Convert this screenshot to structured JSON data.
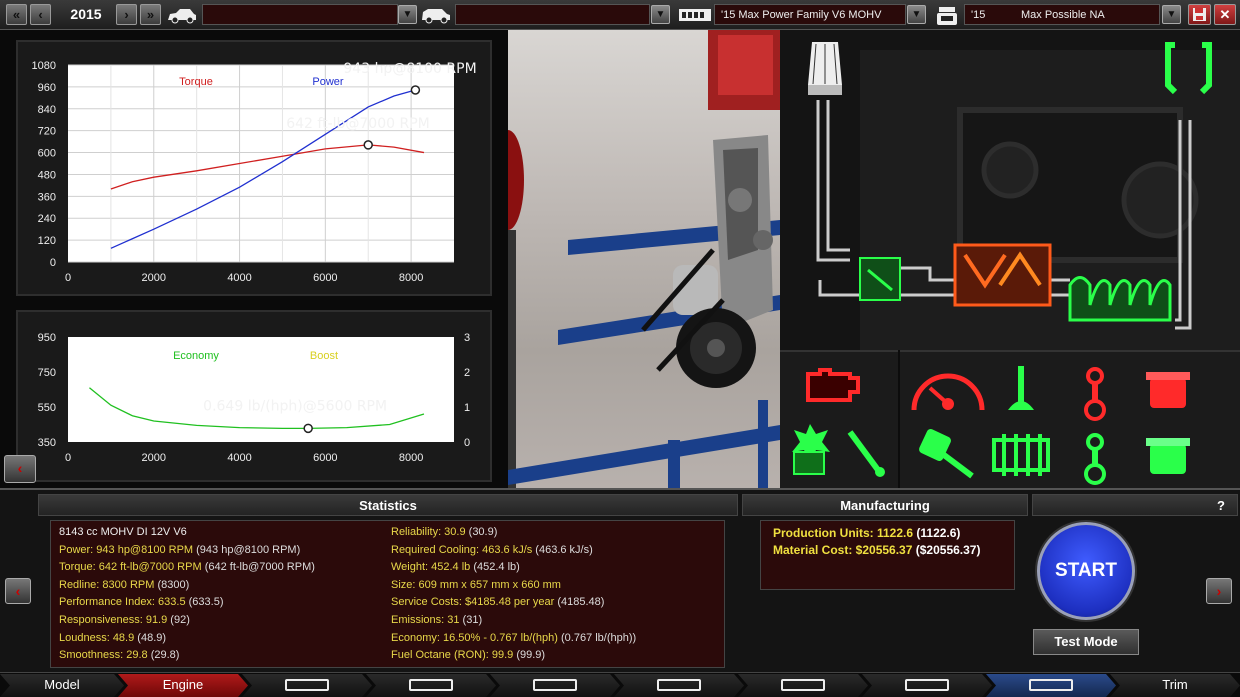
{
  "topbar": {
    "year": "2015",
    "car_model": "",
    "car_trim": "",
    "engine_family": "'15 Max Power Family V6 MOHV",
    "engine_variant_year": "'15",
    "engine_variant": "Max Possible NA",
    "colors": {
      "accent": "#c0392b"
    }
  },
  "chart_data": [
    {
      "type": "line",
      "title": "",
      "legend": [
        "Torque",
        "Power"
      ],
      "xlim": [
        0,
        9000
      ],
      "ylim": [
        0,
        1080
      ],
      "x_ticks": [
        0,
        2000,
        4000,
        6000,
        8000
      ],
      "y_ticks": [
        0,
        120,
        240,
        360,
        480,
        600,
        720,
        840,
        960,
        1080
      ],
      "grid": true,
      "series": [
        {
          "name": "Torque",
          "color": "#d02020",
          "x": [
            1000,
            1500,
            2000,
            3000,
            4000,
            5000,
            6000,
            7000,
            7600,
            8300
          ],
          "y": [
            400,
            440,
            465,
            500,
            540,
            580,
            620,
            642,
            630,
            600
          ]
        },
        {
          "name": "Power",
          "color": "#2030d0",
          "x": [
            1000,
            2000,
            3000,
            4000,
            5000,
            6000,
            7000,
            7600,
            8100
          ],
          "y": [
            75,
            180,
            290,
            410,
            550,
            700,
            850,
            910,
            943
          ]
        }
      ],
      "annotations": [
        {
          "label": "943 hp@8100 RPM",
          "x": 8100,
          "y": 943
        },
        {
          "label": "642 ft-lb@7000 RPM",
          "x": 7000,
          "y": 642
        }
      ]
    },
    {
      "type": "line",
      "title": "",
      "legend": [
        "Economy",
        "Boost"
      ],
      "xlim": [
        0,
        9000
      ],
      "ylim": [
        350,
        950
      ],
      "y_ticks_left": [
        350,
        550,
        750,
        950
      ],
      "y_ticks_right": [
        0,
        1,
        2,
        3
      ],
      "x_ticks": [
        0,
        2000,
        4000,
        6000,
        8000
      ],
      "grid": false,
      "series": [
        {
          "name": "Economy",
          "color": "#20c020",
          "x": [
            500,
            1000,
            1500,
            2000,
            3000,
            4000,
            5000,
            5600,
            6500,
            7500,
            8300
          ],
          "y": [
            660,
            560,
            500,
            470,
            445,
            432,
            428,
            428,
            432,
            450,
            510
          ]
        },
        {
          "name": "Boost",
          "color": "#d8d020",
          "x": [],
          "y": []
        }
      ],
      "annotations": [
        {
          "label": "0.649 lb/(hph)@5600 RPM",
          "x": 5600,
          "y": 428
        }
      ]
    }
  ],
  "stats": {
    "header": "Statistics",
    "left": [
      {
        "label": "8143 cc MOHV DI 12V V6",
        "white": true
      },
      {
        "label": "Power: 943 hp@8100 RPM",
        "paren": "(943 hp@8100 RPM)"
      },
      {
        "label": "Torque: 642 ft-lb@7000 RPM",
        "paren": "(642 ft-lb@7000 RPM)"
      },
      {
        "label": "Redline: 8300 RPM",
        "paren": "(8300)"
      },
      {
        "label": "Performance Index: 633.5",
        "paren": "(633.5)"
      },
      {
        "label": "Responsiveness: 91.9",
        "paren": "(92)"
      },
      {
        "label": "Loudness: 48.9",
        "paren": "(48.9)"
      },
      {
        "label": "Smoothness: 29.8",
        "paren": "(29.8)"
      }
    ],
    "right": [
      {
        "label": "Reliability: 30.9",
        "paren": "(30.9)"
      },
      {
        "label": "Required Cooling: 463.6 kJ/s",
        "paren": "(463.6 kJ/s)"
      },
      {
        "label": "Weight: 452.4 lb",
        "paren": "(452.4 lb)"
      },
      {
        "label": "Size: 609 mm x 657 mm x 660 mm",
        "paren": ""
      },
      {
        "label": "Service Costs: $4185.48 per year",
        "paren": "(4185.48)"
      },
      {
        "label": "Emissions: 31",
        "paren": "(31)"
      },
      {
        "label": "Economy: 16.50% - 0.767 lb/(hph)",
        "paren": "(0.767 lb/(hph))"
      },
      {
        "label": "Fuel Octane (RON): 99.9",
        "paren": "(99.9)"
      }
    ]
  },
  "manufacturing": {
    "header": "Manufacturing",
    "production_units": "Production Units: 1122.6",
    "production_units_paren": "(1122.6)",
    "material_cost": "Material Cost: $20556.37",
    "material_cost_paren": "($20556.37)"
  },
  "controls": {
    "start": "START",
    "test_mode": "Test Mode",
    "help": "?"
  },
  "nav": {
    "tabs": [
      {
        "label": "Model"
      },
      {
        "label": "Engine",
        "active": true
      },
      {
        "label": "",
        "icon": "block-icon"
      },
      {
        "label": "",
        "icon": "crank-icon"
      },
      {
        "label": "",
        "icon": "valvetrain-icon"
      },
      {
        "label": "",
        "icon": "turbo-icon"
      },
      {
        "label": "",
        "icon": "fuel-icon"
      },
      {
        "label": "",
        "icon": "exhaust-icon"
      },
      {
        "label": "",
        "icon": "dyno-icon"
      },
      {
        "label": "Trim"
      }
    ]
  }
}
